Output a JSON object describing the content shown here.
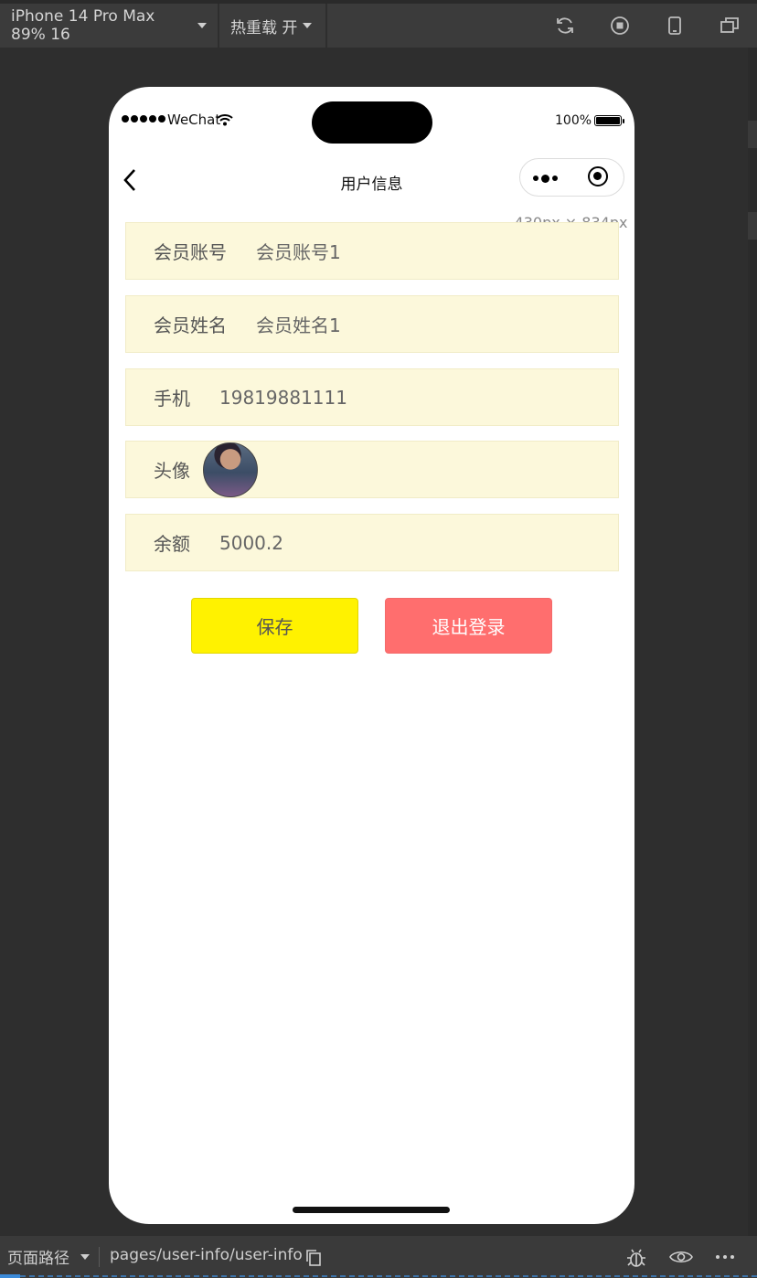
{
  "toolbar": {
    "device_label": "iPhone 14 Pro Max 89% 16",
    "hot_reload_label": "热重载 开",
    "icons": [
      "refresh-icon",
      "stop-icon",
      "phone-icon",
      "window-icon"
    ]
  },
  "status_bar": {
    "carrier": "WeChat",
    "battery": "100%"
  },
  "navbar": {
    "title": "用户信息"
  },
  "size_badge": "430px × 834px",
  "form": {
    "account": {
      "label": "会员账号",
      "value": "会员账号1"
    },
    "name": {
      "label": "会员姓名",
      "value": "会员姓名1"
    },
    "phone": {
      "label": "手机",
      "value": "19819881111"
    },
    "avatar": {
      "label": "头像"
    },
    "balance": {
      "label": "余额",
      "value": "5000.2"
    }
  },
  "buttons": {
    "save": "保存",
    "logout": "退出登录"
  },
  "bottom_bar": {
    "path_label": "页面路径",
    "path": "pages/user-info/user-info"
  },
  "colors": {
    "row_bg": "#fcf8db",
    "save_bg": "#fff200",
    "logout_bg": "#ff6e6e",
    "accent": "#3c8bd9"
  }
}
